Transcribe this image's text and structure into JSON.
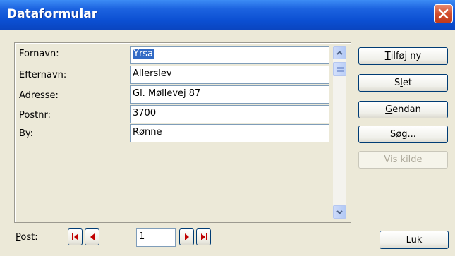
{
  "window": {
    "title": "Dataformular"
  },
  "fields": [
    {
      "label": "Fornavn:",
      "value": "Yrsa"
    },
    {
      "label": "Efternavn:",
      "value": "Allerslev"
    },
    {
      "label": "Adresse:",
      "value": "Gl. Møllevej 87"
    },
    {
      "label": "Postnr:",
      "value": "3700"
    },
    {
      "label": "By:",
      "value": "Rønne"
    }
  ],
  "buttons": {
    "add_new": {
      "access_key": "T",
      "rest": "ilføj ny"
    },
    "delete": {
      "access_key": "l",
      "pre": "S",
      "rest": "et"
    },
    "restore": {
      "access_key": "G",
      "rest": "endan"
    },
    "search": {
      "access_key": "ø",
      "pre": "S",
      "rest": "g..."
    },
    "show_source": "Vis kilde",
    "close": "Luk"
  },
  "record_nav": {
    "label_access_key": "P",
    "label_rest": "ost:",
    "current": "1"
  },
  "colors": {
    "title_bar": "#0B4FD2",
    "close_button": "#D24F2F",
    "dialog_bg": "#ECE9D8",
    "selection": "#316AC5",
    "nav_arrow": "#C00000"
  }
}
